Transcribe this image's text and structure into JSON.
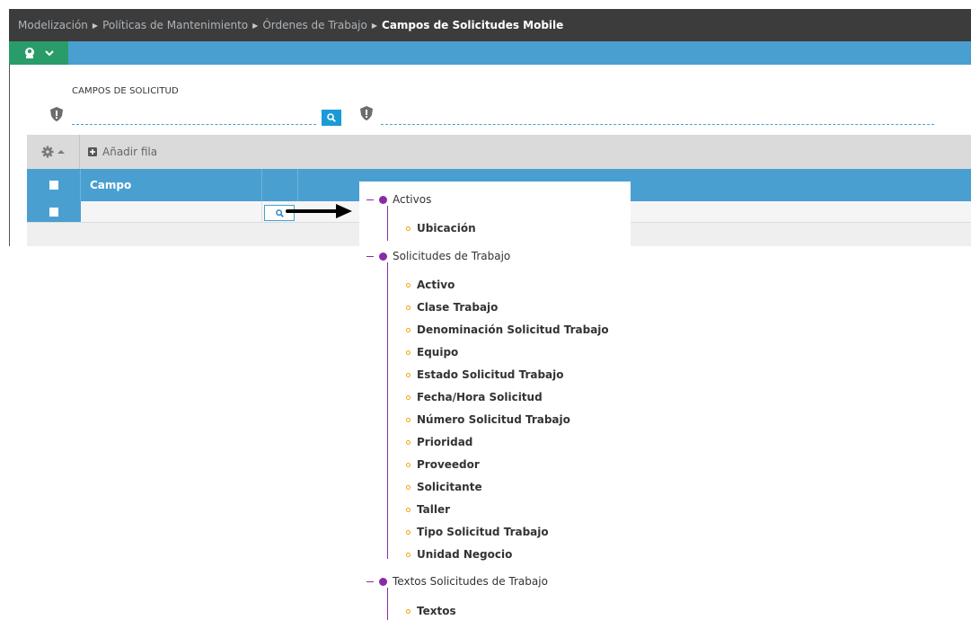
{
  "breadcrumb": [
    "Modelización",
    "Políticas de Mantenimiento",
    "Órdenes de Trabajo",
    "Campos de Solicitudes Mobile"
  ],
  "toolbar": {
    "menu_icon": "user-avatar-icon",
    "chevron_icon": "chevron-down-icon"
  },
  "filter": {
    "label": "CAMPOS DE SOLICITUD",
    "value": "",
    "search_icon": "search-icon"
  },
  "grid": {
    "toolbar": {
      "settings_icon": "gear-icon",
      "add_row_label": "Añadir fila"
    },
    "columns": [
      "Campo"
    ],
    "rows": [
      {
        "campo": ""
      }
    ]
  },
  "tree": {
    "groups": [
      {
        "label": "Activos",
        "items": [
          "Ubicación"
        ]
      },
      {
        "label": "Solicitudes de Trabajo",
        "items": [
          "Activo",
          "Clase Trabajo",
          "Denominación Solicitud Trabajo",
          "Equipo",
          "Estado Solicitud Trabajo",
          "Fecha/Hora Solicitud",
          "Número Solicitud Trabajo",
          "Prioridad",
          "Proveedor",
          "Solicitante",
          "Taller",
          "Tipo Solicitud Trabajo",
          "Unidad Negocio"
        ]
      },
      {
        "label": "Textos Solicitudes de Trabajo",
        "items": [
          "Textos"
        ]
      }
    ]
  },
  "colors": {
    "accent": "#4a9fd1",
    "menu_green": "#2a9c6a",
    "tree_purple": "#8a2aa8",
    "leaf_orange": "#f0a500",
    "breadcrumb_bg": "#3c3c3c"
  }
}
